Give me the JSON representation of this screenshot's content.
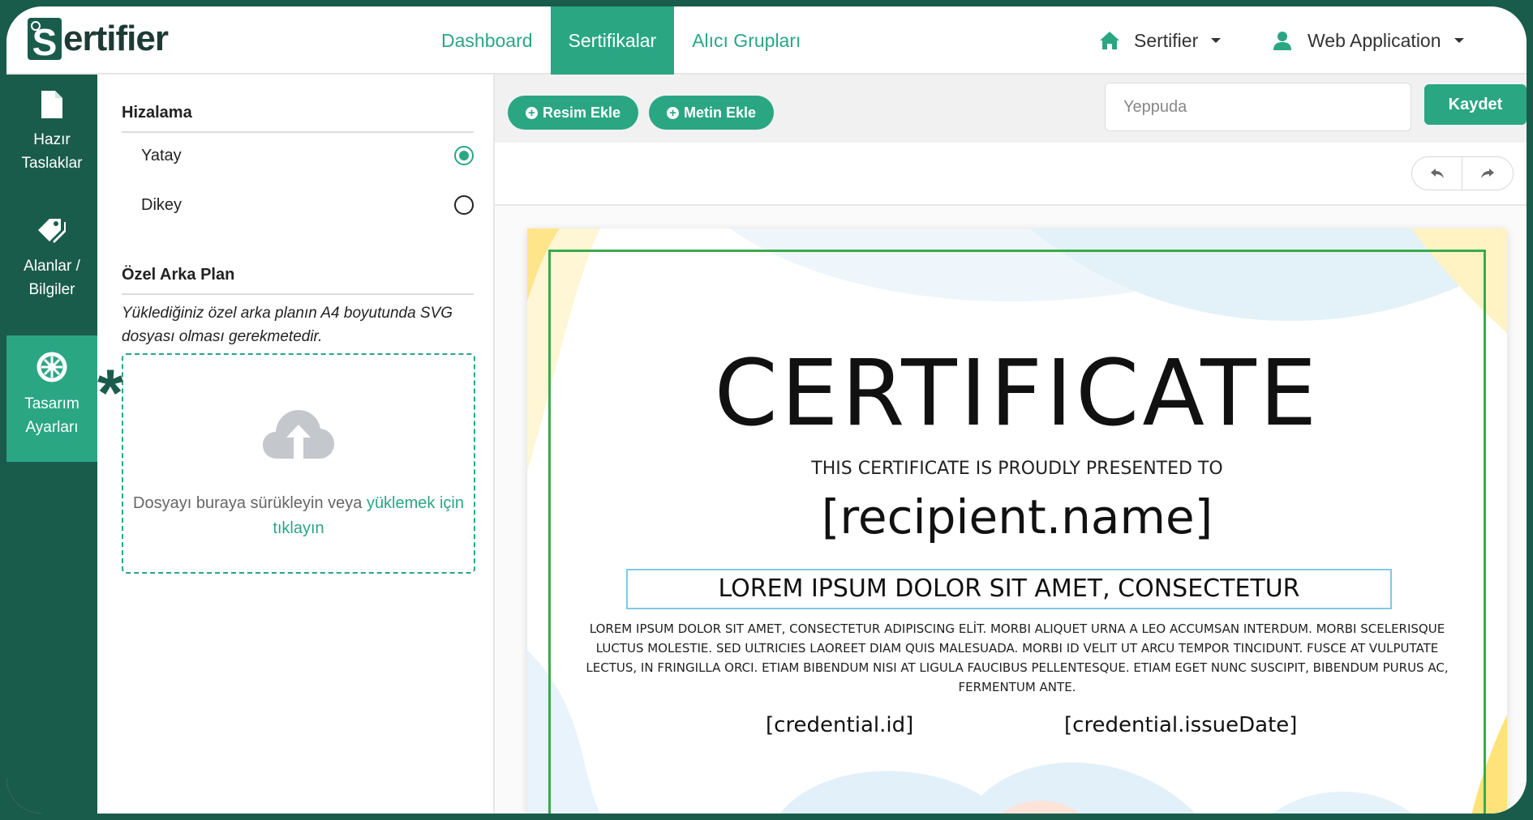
{
  "app": {
    "logo_text": "ertifier",
    "logo_s": "S"
  },
  "nav": {
    "items": [
      {
        "label": "Dashboard",
        "active": false
      },
      {
        "label": "Sertifikalar",
        "active": true
      },
      {
        "label": "Alıcı Grupları",
        "active": false
      }
    ],
    "org_label": "Sertifier",
    "user_label": "Web Application"
  },
  "rail": {
    "items": [
      {
        "line1": "Hazır",
        "line2": "Taslaklar",
        "icon": "file-icon",
        "active": false
      },
      {
        "line1": "Alanlar /",
        "line2": "Bilgiler",
        "icon": "tags-icon",
        "active": false
      },
      {
        "line1": "Tasarım",
        "line2": "Ayarları",
        "icon": "gear-icon",
        "active": true
      }
    ]
  },
  "panel": {
    "alignment_title": "Hizalama",
    "horizontal_label": "Yatay",
    "vertical_label": "Dikey",
    "selected": "horizontal",
    "bg_title": "Özel Arka Plan",
    "bg_help": "Yüklediğiniz özel arka planın A4 boyutunda SVG dosyası olması gerekmetedir.",
    "dropzone_text": "Dosyayı buraya sürükleyin veya ",
    "dropzone_link": "yüklemek için tıklayın",
    "asterisk": "*"
  },
  "toolbar": {
    "add_image_label": "Resim Ekle",
    "add_text_label": "Metin Ekle",
    "name_value": "",
    "name_placeholder": "Yeppuda",
    "save_label": "Kaydet"
  },
  "certificate": {
    "title": "CERTIFICATE",
    "subtitle": "THIS CERTIFICATE IS PROUDLY PRESENTED TO",
    "recipient": "[recipient.name]",
    "headline": "LOREM IPSUM DOLOR SIT AMET, CONSECTETUR",
    "body": "LOREM IPSUM DOLOR SIT AMET, CONSECTETUR ADIPISCING ELİT. MORBI ALIQUET URNA A LEO ACCUMSAN INTERDUM. MORBI SCELERISQUE LUCTUS MOLESTIE. SED ULTRICIES LAOREET DIAM QUIS MALESUADA. MORBI ID VELIT UT ARCU TEMPOR TINCIDUNT. FUSCE AT VULPUTATE LECTUS, IN FRINGILLA ORCI. ETIAM BIBENDUM NISI AT LIGULA FAUCIBUS PELLENTESQUE. ETIAM EGET NUNC SUSCIPIT, BIBENDUM PURUS AC, FERMENTUM ANTE.",
    "credential_id": "[credential.id]",
    "issue_date": "[credential.issueDate]"
  },
  "colors": {
    "brand_dark": "#1a5c4c",
    "brand_accent": "#2aa683",
    "frame_green": "#3aaa4a"
  }
}
